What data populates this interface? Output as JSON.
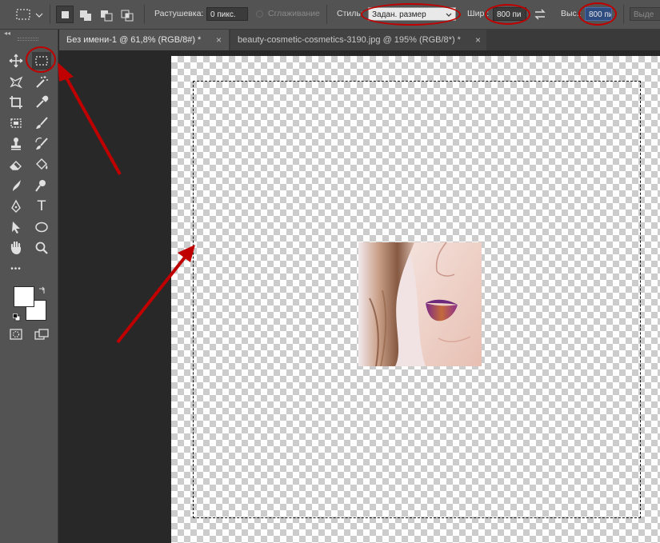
{
  "options_bar": {
    "feather_label": "Растушевка:",
    "feather_value": "0 пикс.",
    "antialias_label": "Сглаживание",
    "style_label": "Стиль:",
    "style_value": "Задан. размер",
    "width_label": "Шир.:",
    "width_value": "800 пи",
    "height_label": "Выс.:",
    "height_value": "800 пи",
    "select_mask_label": "Выде"
  },
  "tabs": [
    {
      "label": "Без имени-1 @ 61,8% (RGB/8#) *",
      "active": true
    },
    {
      "label": "beauty-cosmetic-cosmetics-3190.jpg @ 195% (RGB/8*) *",
      "active": false
    }
  ],
  "toolbar": {
    "tools": [
      "move-icon",
      "rectangular-marquee-icon",
      "lasso-icon",
      "magic-wand-icon",
      "crop-icon",
      "eyedropper-icon",
      "frame-icon",
      "brush-icon",
      "clone-stamp-icon",
      "history-brush-icon",
      "eraser-icon",
      "paint-bucket-icon",
      "smudge-icon",
      "dodge-icon",
      "pen-icon",
      "type-icon",
      "path-selection-icon",
      "ellipse-icon",
      "hand-icon",
      "zoom-icon",
      "more-tools-icon"
    ],
    "type_tool_glyph": "T",
    "more_glyph": "•••"
  },
  "colors": {
    "annotation_red": "#c00000",
    "panel": "#535353",
    "background": "#282828"
  }
}
